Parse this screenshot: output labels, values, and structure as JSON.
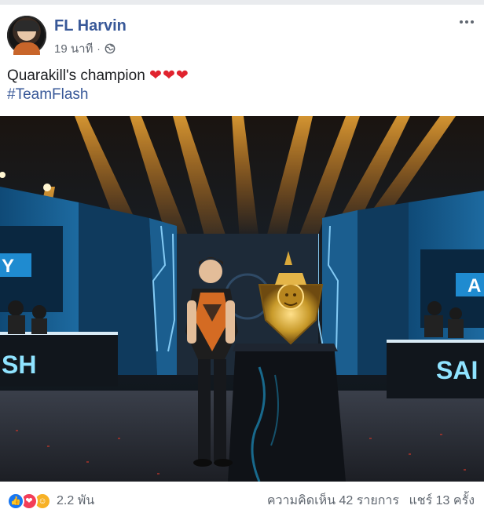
{
  "post": {
    "author": "FL Harvin",
    "time": "19 นาที",
    "privacy_icon": "globe-icon",
    "text": "Quarakill's champion",
    "emoji": "❤❤❤",
    "hashtag": "#TeamFlash",
    "photo": {
      "left_screen_text": "Y",
      "left_desk_text": "SH",
      "right_screen_text": "A",
      "right_desk_text": "SAI"
    }
  },
  "footer": {
    "reaction_icons": [
      "like-icon",
      "love-icon",
      "care-icon"
    ],
    "reaction_count": "2.2 พัน",
    "comments": "ความคิดเห็น 42 รายการ",
    "shares": "แชร์ 13 ครั้ง"
  },
  "colors": {
    "author_link": "#385898",
    "hashtag": "#385898",
    "heart": "#e0232e",
    "muted_text": "#606770"
  }
}
